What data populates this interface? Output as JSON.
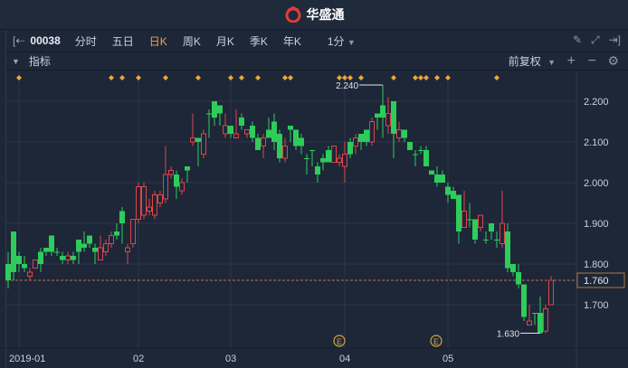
{
  "app": {
    "name": "华盛通",
    "logo_color": "#e23b3b"
  },
  "toolbar": {
    "stock_code": "00038",
    "tabs": [
      "分时",
      "五日",
      "日K",
      "周K",
      "月K",
      "季K",
      "年K"
    ],
    "active_tab": "日K",
    "interval": "1分"
  },
  "indicator_bar": {
    "label": "指标",
    "adjust": "前复权"
  },
  "colors": {
    "up": "#e0454a",
    "down": "#2ecc5b",
    "accent": "#f0a63a"
  },
  "chart_data": {
    "type": "candlestick",
    "ylim": [
      1.62,
      2.26
    ],
    "yticks": [
      "2.200",
      "2.100",
      "2.000",
      "1.900",
      "1.800",
      "1.700"
    ],
    "ytick_values": [
      2.2,
      2.1,
      2.0,
      1.9,
      1.8,
      1.7
    ],
    "x_labels": [
      {
        "label": "2019-01",
        "index": 2
      },
      {
        "label": "02",
        "index": 24
      },
      {
        "label": "03",
        "index": 41
      },
      {
        "label": "04",
        "index": 62
      },
      {
        "label": "05",
        "index": 81
      }
    ],
    "current_price": "1.760",
    "max_label": "2.240",
    "max_index": 69,
    "min_label": "1.630",
    "min_index": 98,
    "event_marker_indices": [
      2,
      19,
      21,
      24,
      29,
      35,
      41,
      43,
      46,
      51,
      52,
      61,
      62,
      63,
      65,
      71,
      75,
      76,
      77,
      79,
      81,
      90
    ],
    "earnings_marker_indices": [
      61,
      79
    ],
    "earnings_label": "E",
    "ohlc": [
      [
        1.8,
        1.83,
        1.74,
        1.76
      ],
      [
        1.88,
        1.88,
        1.76,
        1.78
      ],
      [
        1.82,
        1.83,
        1.78,
        1.8
      ],
      [
        1.8,
        1.82,
        1.78,
        1.79
      ],
      [
        1.77,
        1.79,
        1.76,
        1.78
      ],
      [
        1.79,
        1.81,
        1.79,
        1.81
      ],
      [
        1.83,
        1.84,
        1.78,
        1.8
      ],
      [
        1.84,
        1.84,
        1.82,
        1.83
      ],
      [
        1.87,
        1.87,
        1.82,
        1.83
      ],
      [
        1.83,
        1.84,
        1.82,
        1.83
      ],
      [
        1.82,
        1.83,
        1.8,
        1.81
      ],
      [
        1.81,
        1.83,
        1.8,
        1.82
      ],
      [
        1.82,
        1.83,
        1.8,
        1.81
      ],
      [
        1.86,
        1.86,
        1.8,
        1.83
      ],
      [
        1.85,
        1.88,
        1.83,
        1.84
      ],
      [
        1.87,
        1.87,
        1.84,
        1.85
      ],
      [
        1.84,
        1.85,
        1.8,
        1.83
      ],
      [
        1.81,
        1.87,
        1.81,
        1.84
      ],
      [
        1.83,
        1.86,
        1.82,
        1.85
      ],
      [
        1.85,
        1.88,
        1.84,
        1.87
      ],
      [
        1.88,
        1.9,
        1.86,
        1.87
      ],
      [
        1.93,
        1.94,
        1.85,
        1.9
      ],
      [
        1.83,
        1.85,
        1.8,
        1.84
      ],
      [
        1.85,
        1.91,
        1.84,
        1.91
      ],
      [
        1.91,
        2.0,
        1.9,
        1.99
      ],
      [
        1.92,
        2.0,
        1.91,
        1.99
      ],
      [
        1.93,
        1.96,
        1.92,
        1.94
      ],
      [
        1.92,
        1.98,
        1.91,
        1.97
      ],
      [
        1.95,
        1.98,
        1.94,
        1.97
      ],
      [
        1.96,
        2.09,
        1.95,
        2.02
      ],
      [
        2.02,
        2.04,
        2.01,
        2.03
      ],
      [
        2.02,
        2.03,
        1.96,
        1.99
      ],
      [
        1.98,
        2.01,
        1.97,
        2.0
      ],
      [
        2.04,
        2.04,
        2.0,
        2.03
      ],
      [
        2.1,
        2.17,
        2.09,
        2.11
      ],
      [
        2.11,
        2.11,
        2.04,
        2.1
      ],
      [
        2.07,
        2.13,
        2.06,
        2.12
      ],
      [
        2.17,
        2.18,
        2.11,
        2.17
      ],
      [
        2.2,
        2.2,
        2.14,
        2.16
      ],
      [
        2.19,
        2.19,
        2.14,
        2.17
      ],
      [
        2.12,
        2.17,
        2.11,
        2.14
      ],
      [
        2.14,
        2.14,
        2.11,
        2.12
      ],
      [
        2.11,
        2.18,
        2.11,
        2.12
      ],
      [
        2.16,
        2.17,
        2.13,
        2.14
      ],
      [
        2.12,
        2.13,
        2.11,
        2.13
      ],
      [
        2.14,
        2.15,
        2.1,
        2.11
      ],
      [
        2.11,
        2.12,
        2.08,
        2.08
      ],
      [
        2.09,
        2.12,
        2.06,
        2.11
      ],
      [
        2.13,
        2.16,
        2.11,
        2.11
      ],
      [
        2.15,
        2.17,
        2.08,
        2.1
      ],
      [
        2.12,
        2.13,
        2.05,
        2.06
      ],
      [
        2.06,
        2.11,
        2.05,
        2.09
      ],
      [
        2.14,
        2.14,
        2.1,
        2.13
      ],
      [
        2.13,
        2.13,
        2.08,
        2.09
      ],
      [
        2.11,
        2.12,
        2.07,
        2.09
      ],
      [
        2.06,
        2.07,
        2.02,
        2.06
      ],
      [
        2.08,
        2.08,
        2.04,
        2.08
      ],
      [
        2.04,
        2.05,
        2.0,
        2.02
      ],
      [
        2.06,
        2.07,
        2.03,
        2.05
      ],
      [
        2.08,
        2.09,
        2.05,
        2.05
      ],
      [
        2.05,
        2.09,
        2.05,
        2.09
      ],
      [
        2.05,
        2.07,
        2.04,
        2.06
      ],
      [
        2.04,
        2.1,
        2.0,
        2.07
      ],
      [
        2.1,
        2.11,
        2.06,
        2.07
      ],
      [
        2.09,
        2.12,
        2.07,
        2.11
      ],
      [
        2.12,
        2.12,
        2.08,
        2.1
      ],
      [
        2.13,
        2.13,
        2.09,
        2.1
      ],
      [
        2.1,
        2.16,
        2.09,
        2.15
      ],
      [
        2.17,
        2.17,
        2.13,
        2.16
      ],
      [
        2.19,
        2.24,
        2.11,
        2.16
      ],
      [
        2.14,
        2.21,
        2.12,
        2.17
      ],
      [
        2.2,
        2.2,
        2.06,
        2.12
      ],
      [
        2.11,
        2.15,
        2.1,
        2.13
      ],
      [
        2.13,
        2.13,
        2.1,
        2.11
      ],
      [
        2.1,
        2.1,
        2.08,
        2.08
      ],
      [
        2.07,
        2.08,
        2.04,
        2.07
      ],
      [
        2.08,
        2.09,
        2.07,
        2.08
      ],
      [
        2.08,
        2.09,
        2.04,
        2.04
      ],
      [
        2.03,
        2.03,
        2.02,
        2.02
      ],
      [
        2.02,
        2.04,
        1.99,
        2.0
      ],
      [
        2.02,
        2.03,
        2.0,
        2.0
      ],
      [
        1.99,
        2.0,
        1.95,
        1.97
      ],
      [
        1.98,
        1.99,
        1.96,
        1.96
      ],
      [
        1.97,
        1.97,
        1.85,
        1.88
      ],
      [
        1.89,
        1.98,
        1.89,
        1.93
      ],
      [
        1.91,
        1.95,
        1.89,
        1.91
      ],
      [
        1.91,
        1.91,
        1.85,
        1.86
      ],
      [
        1.89,
        1.92,
        1.88,
        1.92
      ],
      [
        1.86,
        1.88,
        1.85,
        1.86
      ],
      [
        1.9,
        1.9,
        1.86,
        1.88
      ],
      [
        1.86,
        1.88,
        1.84,
        1.86
      ],
      [
        1.85,
        1.98,
        1.84,
        1.9
      ],
      [
        1.88,
        1.9,
        1.78,
        1.79
      ],
      [
        1.8,
        1.8,
        1.77,
        1.78
      ],
      [
        1.78,
        1.8,
        1.74,
        1.75
      ],
      [
        1.75,
        1.75,
        1.66,
        1.67
      ],
      [
        1.65,
        1.7,
        1.65,
        1.66
      ],
      [
        1.68,
        1.68,
        1.65,
        1.68
      ],
      [
        1.68,
        1.72,
        1.63,
        1.63
      ],
      [
        1.635,
        1.7,
        1.63,
        1.69
      ],
      [
        1.7,
        1.77,
        1.7,
        1.76
      ]
    ]
  }
}
